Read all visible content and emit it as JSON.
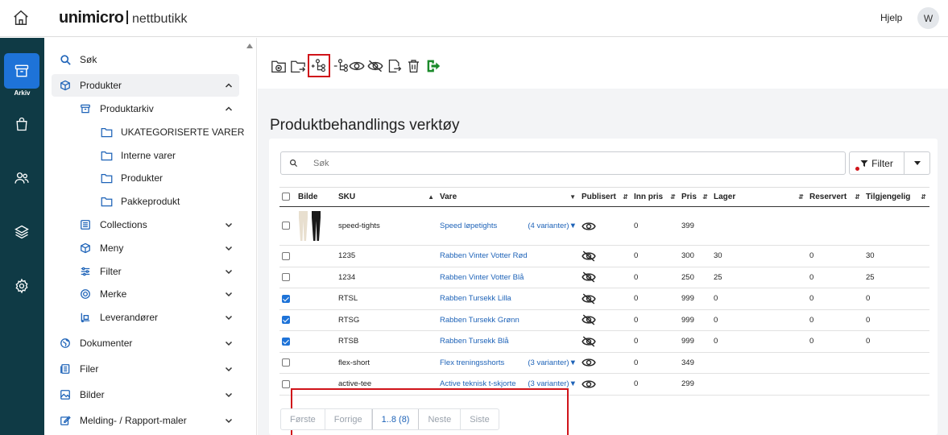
{
  "header": {
    "brand": "unimicro",
    "product": "nettbutikk",
    "help_label": "Hjelp",
    "avatar_initial": "W"
  },
  "rail": {
    "active_label": "Arkiv",
    "items": [
      "archive-icon",
      "shopping-bag-icon",
      "users-icon",
      "layers-icon",
      "gear-icon"
    ]
  },
  "sidenav": {
    "search": "Søk",
    "products": "Produkter",
    "product_archive": "Produktarkiv",
    "uncategorized": "UKATEGORISERTE VARER",
    "internal": "Interne varer",
    "products_folder": "Produkter",
    "package": "Pakkeprodukt",
    "collections": "Collections",
    "menu": "Meny",
    "filter": "Filter",
    "brand": "Merke",
    "suppliers": "Leverandører",
    "documents": "Dokumenter",
    "files": "Filer",
    "images": "Bilder",
    "templates": "Melding- / Rapport-maler"
  },
  "main": {
    "title": "Produktbehandlings verktøy",
    "search_placeholder": "Søk",
    "filter_label": "Filter"
  },
  "table": {
    "headers": {
      "image": "Bilde",
      "sku": "SKU",
      "item": "Vare",
      "published": "Publisert",
      "purchase_price": "Inn pris",
      "price": "Pris",
      "stock": "Lager",
      "reserved": "Reservert",
      "available": "Tilgjengelig"
    },
    "rows": [
      {
        "sku": "speed-tights",
        "item": "Speed løpetights",
        "variants": "(4 varianter)",
        "published": "visible",
        "purchase_price": "0",
        "price": "399",
        "stock": "",
        "reserved": "",
        "available": "",
        "checked": false,
        "image": true
      },
      {
        "sku": "1235",
        "item": "Rabben Vinter Votter Rød",
        "variants": "",
        "published": "hidden",
        "purchase_price": "0",
        "price": "300",
        "stock": "30",
        "reserved": "0",
        "available": "30",
        "checked": false,
        "image": false
      },
      {
        "sku": "1234",
        "item": "Rabben Vinter Votter Blå",
        "variants": "",
        "published": "hidden",
        "purchase_price": "0",
        "price": "250",
        "stock": "25",
        "reserved": "0",
        "available": "25",
        "checked": false,
        "image": false
      },
      {
        "sku": "RTSL",
        "item": "Rabben Tursekk Lilla",
        "variants": "",
        "published": "hidden",
        "purchase_price": "0",
        "price": "999",
        "stock": "0",
        "reserved": "0",
        "available": "0",
        "checked": true,
        "image": false
      },
      {
        "sku": "RTSG",
        "item": "Rabben Tursekk Grønn",
        "variants": "",
        "published": "hidden",
        "purchase_price": "0",
        "price": "999",
        "stock": "0",
        "reserved": "0",
        "available": "0",
        "checked": true,
        "image": false
      },
      {
        "sku": "RTSB",
        "item": "Rabben Tursekk Blå",
        "variants": "",
        "published": "hidden",
        "purchase_price": "0",
        "price": "999",
        "stock": "0",
        "reserved": "0",
        "available": "0",
        "checked": true,
        "image": false
      },
      {
        "sku": "flex-short",
        "item": "Flex treningsshorts",
        "variants": "(3 varianter)",
        "published": "visible",
        "purchase_price": "0",
        "price": "349",
        "stock": "",
        "reserved": "",
        "available": "",
        "checked": false,
        "image": false
      },
      {
        "sku": "active-tee",
        "item": "Active teknisk t-skjorte",
        "variants": "(3 varianter)",
        "published": "visible",
        "purchase_price": "0",
        "price": "299",
        "stock": "",
        "reserved": "",
        "available": "",
        "checked": false,
        "image": false
      }
    ]
  },
  "pager": {
    "first": "Første",
    "prev": "Forrige",
    "current": "1..8 (8)",
    "next": "Neste",
    "last": "Siste"
  },
  "colors": {
    "rail_bg": "#0f3a45",
    "accent": "#1e73d8",
    "highlight": "#d0141a",
    "export_green": "#1a8a2a"
  }
}
